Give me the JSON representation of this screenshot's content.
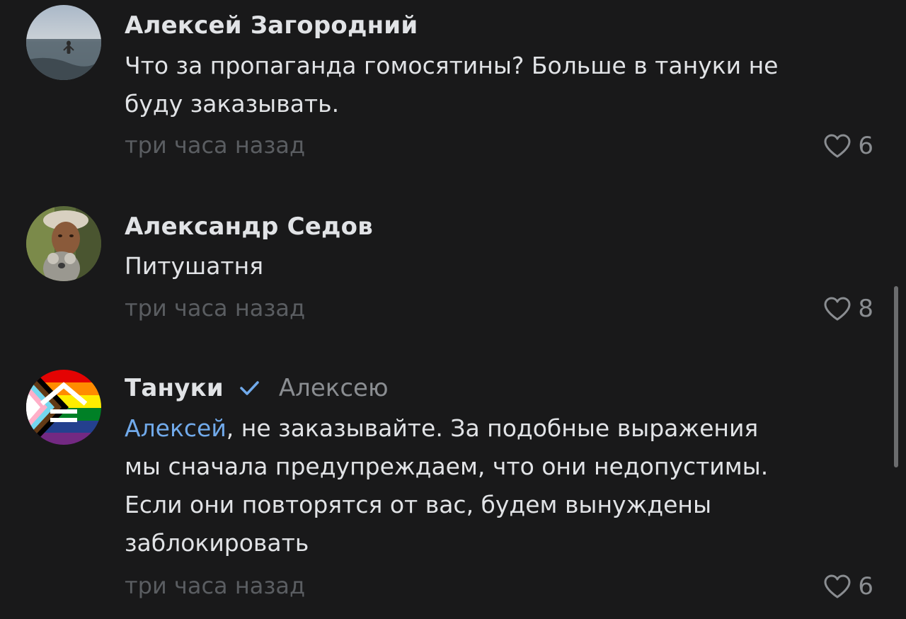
{
  "comments": [
    {
      "author": "Алексей Загородний",
      "reply_to": "",
      "text_lines": [
        "Что за пропаганда гомосятины? Больше в тануки не",
        "буду заказывать."
      ],
      "time": "три часа назад",
      "likes": "6",
      "avatar_icon": "beach-swimmer-photo"
    },
    {
      "author": "Александр Седов",
      "reply_to": "",
      "text_lines": [
        "Питушатня"
      ],
      "time": "три часа назад",
      "likes": "8",
      "avatar_icon": "child-with-koala-photo"
    },
    {
      "author": "Тануки",
      "verified": true,
      "reply_to": "Алексею",
      "mention": "Алексей",
      "text_first_rest": ", не заказывайте. За подобные выражения",
      "text_lines": [
        "мы сначала предупреждаем, что они недопустимы.",
        "Если они повторятся от вас, будем вынуждены",
        "заблокировать"
      ],
      "time": "три часа назад",
      "likes": "6",
      "avatar_icon": "progress-pride-logo"
    }
  ],
  "colors": {
    "background": "#19191a",
    "text": "#e1e3e6",
    "secondary": "#8a8d91",
    "time": "#5a5d61",
    "link": "#71aaeb"
  },
  "icons": {
    "like": "heart-outline-icon",
    "verified": "checkmark-icon"
  }
}
